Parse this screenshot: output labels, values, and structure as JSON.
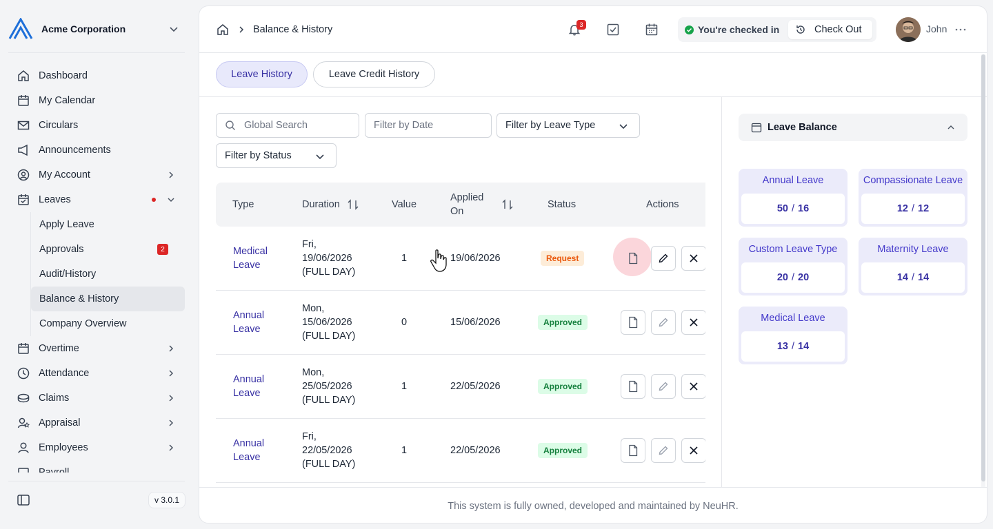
{
  "org": {
    "name": "Acme Corporation"
  },
  "sidebar": {
    "items": [
      {
        "label": "Dashboard",
        "icon": "home-icon"
      },
      {
        "label": "My Calendar",
        "icon": "calendar-icon"
      },
      {
        "label": "Circulars",
        "icon": "mail-icon"
      },
      {
        "label": "Announcements",
        "icon": "megaphone-icon"
      },
      {
        "label": "My Account",
        "icon": "user-circle-icon"
      },
      {
        "label": "Leaves",
        "icon": "calendar-check-icon"
      }
    ],
    "leaves_sub": [
      {
        "label": "Apply Leave"
      },
      {
        "label": "Approvals",
        "badge": "2"
      },
      {
        "label": "Audit/History"
      },
      {
        "label": "Balance & History"
      },
      {
        "label": "Company Overview"
      }
    ],
    "items_after": [
      {
        "label": "Overtime",
        "icon": "calendar-clock-icon"
      },
      {
        "label": "Attendance",
        "icon": "clock-icon"
      },
      {
        "label": "Claims",
        "icon": "coins-icon"
      },
      {
        "label": "Appraisal",
        "icon": "user-star-icon"
      },
      {
        "label": "Employees",
        "icon": "user-icon"
      },
      {
        "label": "Payroll",
        "icon": "payroll-icon"
      }
    ],
    "version": "v 3.0.1"
  },
  "topbar": {
    "breadcrumb": "Balance & History",
    "notification_count": "3",
    "checkin_status": "You're checked in",
    "checkout_label": "Check Out",
    "user_name": "John"
  },
  "tabs": [
    {
      "label": "Leave History",
      "active": true
    },
    {
      "label": "Leave Credit History",
      "active": false
    }
  ],
  "filters": {
    "search_placeholder": "Global Search",
    "date_placeholder": "Filter by Date",
    "leave_type": "Filter by Leave Type",
    "status": "Filter by Status"
  },
  "table": {
    "headers": {
      "type": "Type",
      "duration": "Duration",
      "value": "Value",
      "applied_line1": "Applied",
      "applied_line2": "On",
      "status": "Status",
      "actions": "Actions"
    },
    "rows": [
      {
        "type1": "Medical",
        "type2": "Leave",
        "d1": "Fri,",
        "d2": "19/06/2026",
        "d3": "(FULL DAY)",
        "value": "1",
        "applied": "19/06/2026",
        "status": "Request"
      },
      {
        "type1": "Annual",
        "type2": "Leave",
        "d1": "Mon,",
        "d2": "15/06/2026",
        "d3": "(FULL DAY)",
        "value": "0",
        "applied": "15/06/2026",
        "status": "Approved"
      },
      {
        "type1": "Annual",
        "type2": "Leave",
        "d1": "Mon,",
        "d2": "25/05/2026",
        "d3": "(FULL DAY)",
        "value": "1",
        "applied": "22/05/2026",
        "status": "Approved"
      },
      {
        "type1": "Annual",
        "type2": "Leave",
        "d1": "Fri,",
        "d2": "22/05/2026",
        "d3": "(FULL DAY)",
        "value": "1",
        "applied": "22/05/2026",
        "status": "Approved"
      }
    ]
  },
  "leave_balance": {
    "title": "Leave Balance",
    "cards": [
      {
        "name": "Annual Leave",
        "used": "50",
        "total": "16"
      },
      {
        "name": "Compassionate Leave",
        "used": "12",
        "total": "12"
      },
      {
        "name": "Custom Leave Type",
        "used": "20",
        "total": "20"
      },
      {
        "name": "Maternity Leave",
        "used": "14",
        "total": "14"
      },
      {
        "name": "Medical Leave",
        "used": "13",
        "total": "14"
      }
    ]
  },
  "footer": {
    "text": "This system is fully owned, developed and maintained by NeuHR."
  },
  "colors": {
    "accent": "#3730a3",
    "danger": "#dc2626",
    "success": "#16a34a"
  }
}
